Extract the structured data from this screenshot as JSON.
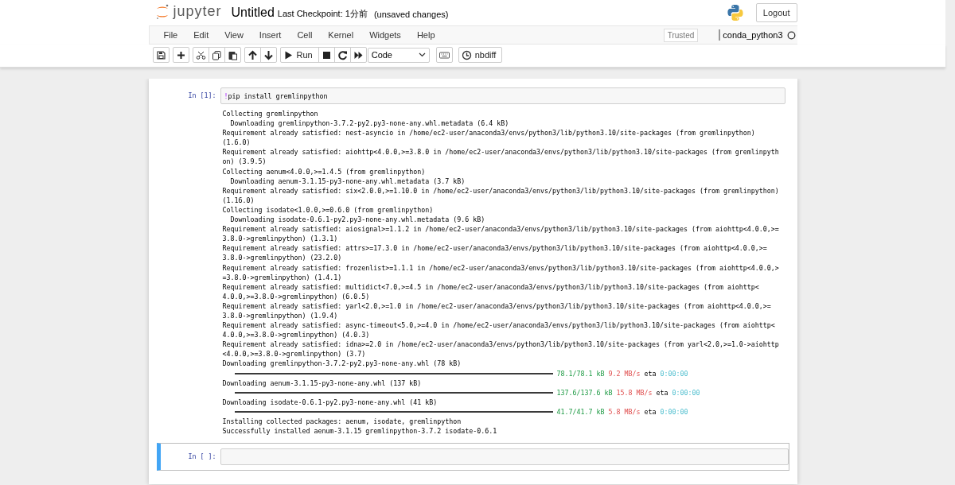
{
  "header": {
    "logo_text": "jupyter",
    "title": "Untitled",
    "checkpoint": "Last Checkpoint: 1分前",
    "save_status": "(unsaved changes)",
    "logout": "Logout"
  },
  "menubar": {
    "items": [
      "File",
      "Edit",
      "View",
      "Insert",
      "Cell",
      "Kernel",
      "Widgets",
      "Help"
    ],
    "trusted": "Trusted",
    "kernel_name": "conda_python3",
    "kernel_busy": false
  },
  "toolbar": {
    "groups": [
      [
        {
          "kind": "save"
        }
      ],
      [
        {
          "kind": "plus"
        }
      ],
      [
        {
          "kind": "cut"
        },
        {
          "kind": "copy"
        },
        {
          "kind": "paste"
        }
      ],
      [
        {
          "kind": "up"
        },
        {
          "kind": "down"
        }
      ],
      [
        {
          "kind": "run",
          "label": "Run"
        },
        {
          "kind": "stop"
        },
        {
          "kind": "restart"
        },
        {
          "kind": "fastforward"
        }
      ]
    ],
    "cell_type": "Code",
    "extra": [
      {
        "kind": "keyboard"
      },
      {
        "kind": "nbdiff",
        "label": "nbdiff"
      }
    ]
  },
  "cells": [
    {
      "prompt": "In [1]:",
      "selected": false,
      "tokens": [
        {
          "kind": "operator",
          "text": "!"
        },
        {
          "kind": "plain",
          "text": "pip install gremlinpython"
        }
      ],
      "output": [
        {
          "kind": "text",
          "text": "Collecting gremlinpython"
        },
        {
          "kind": "text",
          "text": "  Downloading gremlinpython-3.7.2-py2.py3-none-any.whl.metadata (6.4 kB)"
        },
        {
          "kind": "text",
          "text": "Requirement already satisfied: nest-asyncio in /home/ec2-user/anaconda3/envs/python3/lib/python3.10/site-packages (from gremlinpython)"
        },
        {
          "kind": "text",
          "text": "(1.6.0)"
        },
        {
          "kind": "text",
          "text": "Requirement already satisfied: aiohttp<4.0.0,>=3.8.0 in /home/ec2-user/anaconda3/envs/python3/lib/python3.10/site-packages (from gremlinpyth"
        },
        {
          "kind": "text",
          "text": "on) (3.9.5)"
        },
        {
          "kind": "text",
          "text": "Collecting aenum<4.0.0,>=1.4.5 (from gremlinpython)"
        },
        {
          "kind": "text",
          "text": "  Downloading aenum-3.1.15-py3-none-any.whl.metadata (3.7 kB)"
        },
        {
          "kind": "text",
          "text": "Requirement already satisfied: six<2.0.0,>=1.10.0 in /home/ec2-user/anaconda3/envs/python3/lib/python3.10/site-packages (from gremlinpython)"
        },
        {
          "kind": "text",
          "text": "(1.16.0)"
        },
        {
          "kind": "text",
          "text": "Collecting isodate<1.0.0,>=0.6.0 (from gremlinpython)"
        },
        {
          "kind": "text",
          "text": "  Downloading isodate-0.6.1-py2.py3-none-any.whl.metadata (9.6 kB)"
        },
        {
          "kind": "text",
          "text": "Requirement already satisfied: aiosignal>=1.1.2 in /home/ec2-user/anaconda3/envs/python3/lib/python3.10/site-packages (from aiohttp<4.0.0,>="
        },
        {
          "kind": "text",
          "text": "3.8.0->gremlinpython) (1.3.1)"
        },
        {
          "kind": "text",
          "text": "Requirement already satisfied: attrs>=17.3.0 in /home/ec2-user/anaconda3/envs/python3/lib/python3.10/site-packages (from aiohttp<4.0.0,>="
        },
        {
          "kind": "text",
          "text": "3.8.0->gremlinpython) (23.2.0)"
        },
        {
          "kind": "text",
          "text": "Requirement already satisfied: frozenlist>=1.1.1 in /home/ec2-user/anaconda3/envs/python3/lib/python3.10/site-packages (from aiohttp<4.0.0,>"
        },
        {
          "kind": "text",
          "text": "=3.8.0->gremlinpython) (1.4.1)"
        },
        {
          "kind": "text",
          "text": "Requirement already satisfied: multidict<7.0,>=4.5 in /home/ec2-user/anaconda3/envs/python3/lib/python3.10/site-packages (from aiohttp<"
        },
        {
          "kind": "text",
          "text": "4.0.0,>=3.8.0->gremlinpython) (6.0.5)"
        },
        {
          "kind": "text",
          "text": "Requirement already satisfied: yarl<2.0,>=1.0 in /home/ec2-user/anaconda3/envs/python3/lib/python3.10/site-packages (from aiohttp<4.0.0,>="
        },
        {
          "kind": "text",
          "text": "3.8.0->gremlinpython) (1.9.4)"
        },
        {
          "kind": "text",
          "text": "Requirement already satisfied: async-timeout<5.0,>=4.0 in /home/ec2-user/anaconda3/envs/python3/lib/python3.10/site-packages (from aiohttp<"
        },
        {
          "kind": "text",
          "text": "4.0.0,>=3.8.0->gremlinpython) (4.0.3)"
        },
        {
          "kind": "text",
          "text": "Requirement already satisfied: idna>=2.0 in /home/ec2-user/anaconda3/envs/python3/lib/python3.10/site-packages (from yarl<2.0,>=1.0->aiohttp"
        },
        {
          "kind": "text",
          "text": "<4.0.0,>=3.8.0->gremlinpython) (3.7)"
        },
        {
          "kind": "text",
          "text": "Downloading gremlinpython-3.7.2-py2.py3-none-any.whl (78 kB)"
        },
        {
          "kind": "progress",
          "level": 1,
          "done": "78.1/78.1 kB",
          "speed": "9.2 MB/s",
          "eta_label": "eta",
          "eta": "0:00:00"
        },
        {
          "kind": "text",
          "text": "Downloading aenum-3.1.15-py3-none-any.whl (137 kB)"
        },
        {
          "kind": "progress",
          "level": 1,
          "done": "137.6/137.6 kB",
          "speed": "15.8 MB/s",
          "eta_label": "eta",
          "eta": "0:00:00"
        },
        {
          "kind": "text",
          "text": "Downloading isodate-0.6.1-py2.py3-none-any.whl (41 kB)"
        },
        {
          "kind": "progress",
          "level": 1,
          "done": "41.7/41.7 kB",
          "speed": "5.8 MB/s",
          "eta_label": "eta",
          "eta": "0:00:00"
        },
        {
          "kind": "text",
          "text": "Installing collected packages: aenum, isodate, gremlinpython"
        },
        {
          "kind": "text",
          "text": "Successfully installed aenum-3.1.15 gremlinpython-3.7.2 isodate-0.6.1"
        }
      ]
    },
    {
      "prompt": "In [ ]:",
      "selected": true
    }
  ]
}
